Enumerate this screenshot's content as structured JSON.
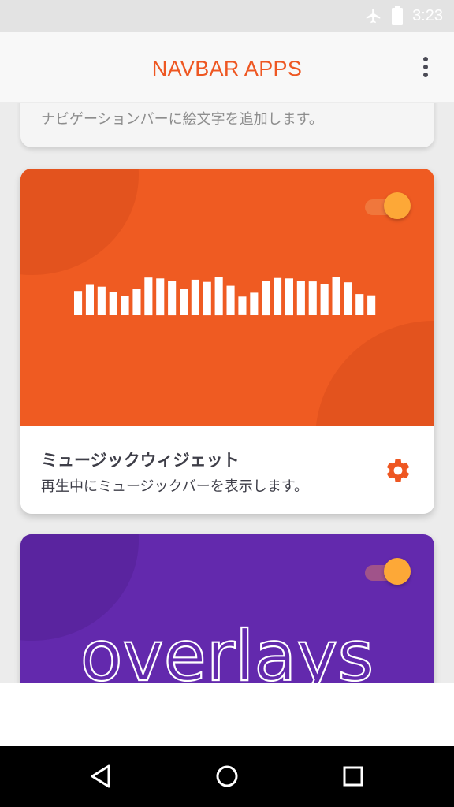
{
  "status_bar": {
    "time": "3:23",
    "icons": [
      "airplane-mode-icon",
      "battery-icon"
    ]
  },
  "app_bar": {
    "title": "NAVBAR APPS",
    "menu_icon": "more-vert-icon"
  },
  "cards": [
    {
      "subtitle": "ナビゲーションバーに絵文字を追加します。"
    },
    {
      "title": "ミュージックウィジェット",
      "subtitle": "再生中にミュージックバーを表示します。",
      "enabled": true,
      "settings_icon": "gear-icon",
      "visualizer_levels": [
        0.56,
        0.7,
        0.66,
        0.54,
        0.44,
        0.6,
        0.87,
        0.85,
        0.79,
        0.6,
        0.82,
        0.77,
        0.89,
        0.68,
        0.43,
        0.52,
        0.79,
        0.86,
        0.85,
        0.79,
        0.78,
        0.72,
        0.88,
        0.76,
        0.49,
        0.46
      ],
      "colors": {
        "banner": "#ef5b22",
        "accent": "#ee5722"
      }
    },
    {
      "banner_text": "overlays",
      "enabled": true,
      "colors": {
        "banner": "#6329ad"
      }
    }
  ],
  "nav_bar": {
    "buttons": [
      "back-icon",
      "home-icon",
      "recents-icon"
    ]
  },
  "colors": {
    "accent": "#ee5722",
    "toggle_thumb": "#fda837",
    "text_primary": "#3e3e48"
  }
}
